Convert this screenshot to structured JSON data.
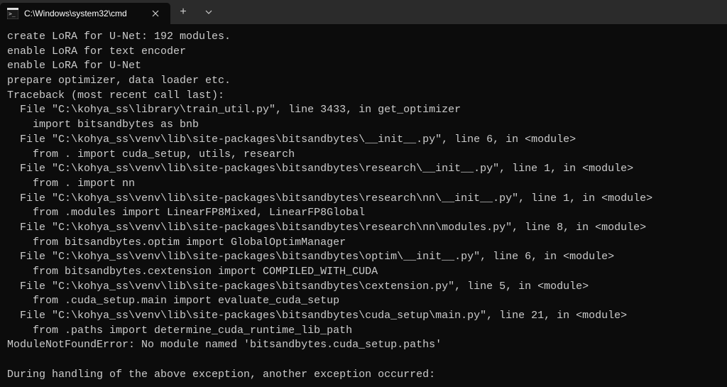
{
  "tab": {
    "title": "C:\\Windows\\system32\\cmd"
  },
  "terminal": {
    "lines": [
      "create LoRA for U-Net: 192 modules.",
      "enable LoRA for text encoder",
      "enable LoRA for U-Net",
      "prepare optimizer, data loader etc.",
      "Traceback (most recent call last):",
      "  File \"C:\\kohya_ss\\library\\train_util.py\", line 3433, in get_optimizer",
      "    import bitsandbytes as bnb",
      "  File \"C:\\kohya_ss\\venv\\lib\\site-packages\\bitsandbytes\\__init__.py\", line 6, in <module>",
      "    from . import cuda_setup, utils, research",
      "  File \"C:\\kohya_ss\\venv\\lib\\site-packages\\bitsandbytes\\research\\__init__.py\", line 1, in <module>",
      "    from . import nn",
      "  File \"C:\\kohya_ss\\venv\\lib\\site-packages\\bitsandbytes\\research\\nn\\__init__.py\", line 1, in <module>",
      "    from .modules import LinearFP8Mixed, LinearFP8Global",
      "  File \"C:\\kohya_ss\\venv\\lib\\site-packages\\bitsandbytes\\research\\nn\\modules.py\", line 8, in <module>",
      "    from bitsandbytes.optim import GlobalOptimManager",
      "  File \"C:\\kohya_ss\\venv\\lib\\site-packages\\bitsandbytes\\optim\\__init__.py\", line 6, in <module>",
      "    from bitsandbytes.cextension import COMPILED_WITH_CUDA",
      "  File \"C:\\kohya_ss\\venv\\lib\\site-packages\\bitsandbytes\\cextension.py\", line 5, in <module>",
      "    from .cuda_setup.main import evaluate_cuda_setup",
      "  File \"C:\\kohya_ss\\venv\\lib\\site-packages\\bitsandbytes\\cuda_setup\\main.py\", line 21, in <module>",
      "    from .paths import determine_cuda_runtime_lib_path",
      "ModuleNotFoundError: No module named 'bitsandbytes.cuda_setup.paths'",
      "",
      "During handling of the above exception, another exception occurred:"
    ]
  }
}
